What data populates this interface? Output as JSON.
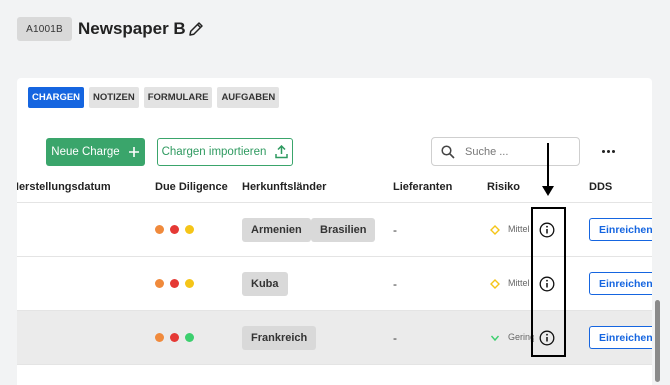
{
  "header": {
    "id_badge": "A1001B",
    "title": "Newspaper B"
  },
  "tabs": [
    {
      "label": "CHARGEN",
      "active": true
    },
    {
      "label": "NOTIZEN",
      "active": false
    },
    {
      "label": "FORMULARE",
      "active": false
    },
    {
      "label": "AUFGABEN",
      "active": false
    }
  ],
  "toolbar": {
    "new_label": "Neue Charge",
    "import_label": "Chargen importieren",
    "search_placeholder": "Suche ..."
  },
  "table": {
    "columns": [
      "Herstellungsdatum",
      "Due Diligence",
      "Herkunftsländer",
      "Lieferanten",
      "Risiko",
      "DDS"
    ],
    "rows": [
      {
        "herstellungsdatum": "",
        "due_diligence": [
          "#f08a3c",
          "#e53935",
          "#f5c518"
        ],
        "countries": [
          "Armenien",
          "Brasilien"
        ],
        "lieferanten": "-",
        "risk_icon": "diamond-icon",
        "risk_color": "#f5c518",
        "risk": "Mittel",
        "dds": "Einreichen"
      },
      {
        "herstellungsdatum": "",
        "due_diligence": [
          "#f08a3c",
          "#e53935",
          "#f5c518"
        ],
        "countries": [
          "Kuba"
        ],
        "lieferanten": "-",
        "risk_icon": "diamond-icon",
        "risk_color": "#f5c518",
        "risk": "Mittel",
        "dds": "Einreichen"
      },
      {
        "herstellungsdatum": "",
        "due_diligence": [
          "#f08a3c",
          "#e53935",
          "#3ccf6e"
        ],
        "countries": [
          "Frankreich"
        ],
        "lieferanten": "-",
        "risk_icon": "chevron-down-icon",
        "risk_color": "#3ccf6e",
        "risk": "Gering",
        "dds": "Einreichen"
      }
    ]
  },
  "colors": {
    "accent": "#1565e0",
    "primary_green": "#3aa56b"
  }
}
